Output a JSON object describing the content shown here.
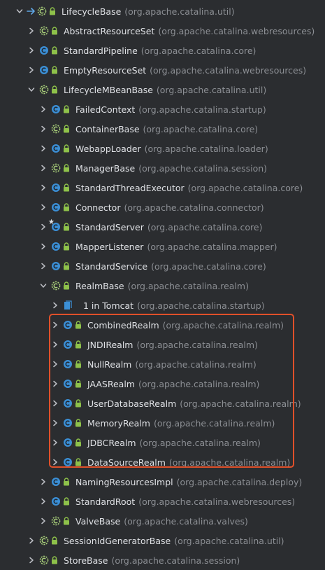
{
  "tree": {
    "rows": [
      {
        "depth": 0,
        "expanded": true,
        "icon": "abstract-class-icon",
        "lock": true,
        "arrow": true,
        "name": "LifecycleBase",
        "pkg": "(org.apache.catalina.util)"
      },
      {
        "depth": 1,
        "expanded": false,
        "icon": "abstract-class-icon",
        "lock": true,
        "name": "AbstractResourceSet",
        "pkg": "(org.apache.catalina.webresources)"
      },
      {
        "depth": 1,
        "expanded": false,
        "icon": "class-icon",
        "lock": true,
        "name": "StandardPipeline",
        "pkg": "(org.apache.catalina.core)"
      },
      {
        "depth": 1,
        "expanded": false,
        "icon": "class-icon",
        "lock": true,
        "name": "EmptyResourceSet",
        "pkg": "(org.apache.catalina.webresources)"
      },
      {
        "depth": 1,
        "expanded": true,
        "icon": "abstract-class-icon",
        "lock": true,
        "name": "LifecycleMBeanBase",
        "pkg": "(org.apache.catalina.util)"
      },
      {
        "depth": 2,
        "expanded": false,
        "icon": "class-icon",
        "lock": true,
        "name": "FailedContext",
        "pkg": "(org.apache.catalina.startup)"
      },
      {
        "depth": 2,
        "expanded": false,
        "icon": "abstract-class-icon",
        "lock": true,
        "name": "ContainerBase",
        "pkg": "(org.apache.catalina.core)"
      },
      {
        "depth": 2,
        "expanded": false,
        "icon": "class-icon",
        "lock": true,
        "name": "WebappLoader",
        "pkg": "(org.apache.catalina.loader)"
      },
      {
        "depth": 2,
        "expanded": false,
        "icon": "abstract-class-icon",
        "lock": true,
        "name": "ManagerBase",
        "pkg": "(org.apache.catalina.session)"
      },
      {
        "depth": 2,
        "expanded": false,
        "icon": "class-icon",
        "lock": true,
        "name": "StandardThreadExecutor",
        "pkg": "(org.apache.catalina.core)"
      },
      {
        "depth": 2,
        "expanded": false,
        "icon": "class-icon",
        "lock": true,
        "name": "Connector",
        "pkg": "(org.apache.catalina.connector)"
      },
      {
        "depth": 2,
        "expanded": false,
        "icon": "class-icon",
        "lock": true,
        "star": true,
        "name": "StandardServer",
        "pkg": "(org.apache.catalina.core)"
      },
      {
        "depth": 2,
        "expanded": false,
        "icon": "class-icon",
        "lock": true,
        "name": "MapperListener",
        "pkg": "(org.apache.catalina.mapper)"
      },
      {
        "depth": 2,
        "expanded": false,
        "icon": "class-icon",
        "lock": true,
        "name": "StandardService",
        "pkg": "(org.apache.catalina.core)"
      },
      {
        "depth": 2,
        "expanded": true,
        "icon": "abstract-class-icon",
        "lock": true,
        "name": "RealmBase",
        "pkg": "(org.apache.catalina.realm)"
      },
      {
        "depth": 3,
        "expanded": false,
        "icon": "anonymous-class-icon",
        "lock": false,
        "name": "1 in Tomcat",
        "pkg": "(org.apache.catalina.startup)"
      },
      {
        "depth": 3,
        "expanded": false,
        "icon": "class-icon",
        "lock": true,
        "name": "CombinedRealm",
        "pkg": "(org.apache.catalina.realm)"
      },
      {
        "depth": 3,
        "expanded": false,
        "icon": "class-icon",
        "lock": true,
        "name": "JNDIRealm",
        "pkg": "(org.apache.catalina.realm)"
      },
      {
        "depth": 3,
        "expanded": false,
        "icon": "class-icon",
        "lock": true,
        "name": "NullRealm",
        "pkg": "(org.apache.catalina.realm)"
      },
      {
        "depth": 3,
        "expanded": false,
        "icon": "class-icon",
        "lock": true,
        "name": "JAASRealm",
        "pkg": "(org.apache.catalina.realm)"
      },
      {
        "depth": 3,
        "expanded": false,
        "icon": "class-icon",
        "lock": true,
        "name": "UserDatabaseRealm",
        "pkg": "(org.apache.catalina.realm)"
      },
      {
        "depth": 3,
        "expanded": false,
        "icon": "class-icon",
        "lock": true,
        "name": "MemoryRealm",
        "pkg": "(org.apache.catalina.realm)"
      },
      {
        "depth": 3,
        "expanded": false,
        "icon": "class-icon",
        "lock": true,
        "name": "JDBCRealm",
        "pkg": "(org.apache.catalina.realm)"
      },
      {
        "depth": 3,
        "expanded": false,
        "icon": "class-icon",
        "lock": true,
        "name": "DataSourceRealm",
        "pkg": "(org.apache.catalina.realm)"
      },
      {
        "depth": 2,
        "expanded": false,
        "icon": "class-icon",
        "lock": true,
        "name": "NamingResourcesImpl",
        "pkg": "(org.apache.catalina.deploy)"
      },
      {
        "depth": 2,
        "expanded": false,
        "icon": "class-icon",
        "lock": true,
        "name": "StandardRoot",
        "pkg": "(org.apache.catalina.webresources)"
      },
      {
        "depth": 2,
        "expanded": false,
        "icon": "abstract-class-icon",
        "lock": true,
        "name": "ValveBase",
        "pkg": "(org.apache.catalina.valves)"
      },
      {
        "depth": 1,
        "expanded": false,
        "icon": "abstract-class-icon",
        "lock": true,
        "name": "SessionIdGeneratorBase",
        "pkg": "(org.apache.catalina.util)"
      },
      {
        "depth": 1,
        "expanded": false,
        "icon": "abstract-class-icon",
        "lock": true,
        "name": "StoreBase",
        "pkg": "(org.apache.catalina.session)"
      }
    ]
  },
  "colors": {
    "background": "#2b2d30",
    "class_icon": "#3b8fd6",
    "abstract_icon": "#a9cf7a",
    "lock": "#8ec14a",
    "package_text": "#8c8f94",
    "highlight_border": "#e0502a"
  }
}
